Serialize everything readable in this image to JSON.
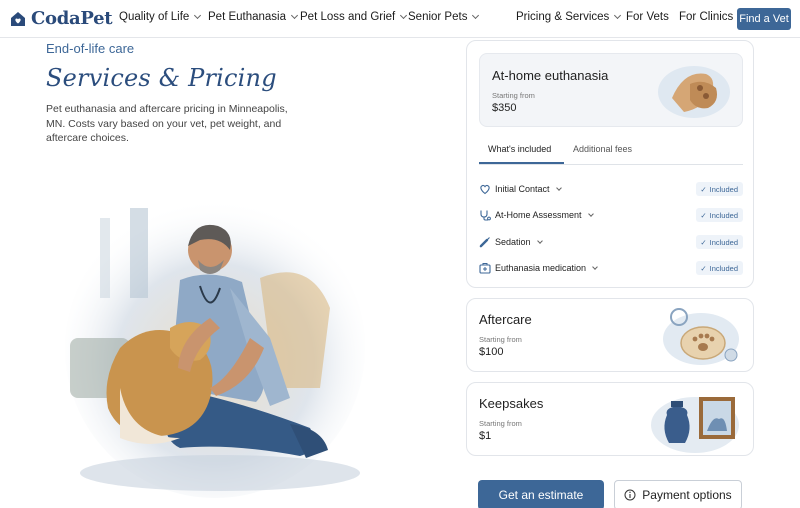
{
  "brand": {
    "name": "CodaPet"
  },
  "nav": {
    "items": [
      {
        "label": "Quality of Life",
        "dropdown": true
      },
      {
        "label": "Pet Euthanasia",
        "dropdown": true
      },
      {
        "label": "Pet Loss and Grief",
        "dropdown": true
      },
      {
        "label": "Senior Pets",
        "dropdown": true
      },
      {
        "label": "Pricing & Services",
        "dropdown": true
      },
      {
        "label": "For Vets",
        "dropdown": false
      },
      {
        "label": "For Clinics",
        "dropdown": false
      }
    ],
    "cta": "Find a Vet"
  },
  "hero": {
    "eyebrow": "End-of-life care",
    "title": "Services & Pricing",
    "description": "Pet euthanasia and aftercare pricing in Minneapolis, MN. Costs vary based on your vet, pet weight, and aftercare choices."
  },
  "main_service": {
    "title": "At-home euthanasia",
    "starting_label": "Starting from",
    "price": "$350",
    "tabs": [
      "What's included",
      "Additional fees"
    ],
    "active_tab": 0,
    "included_items": [
      {
        "label": "Initial Contact",
        "status": "Included",
        "icon": "heart-icon"
      },
      {
        "label": "At-Home Assessment",
        "status": "Included",
        "icon": "stethoscope-icon"
      },
      {
        "label": "Sedation",
        "status": "Included",
        "icon": "syringe-icon"
      },
      {
        "label": "Euthanasia medication",
        "status": "Included",
        "icon": "medical-kit-icon"
      }
    ]
  },
  "aftercare": {
    "title": "Aftercare",
    "starting_label": "Starting from",
    "price": "$100"
  },
  "keepsakes": {
    "title": "Keepsakes",
    "starting_label": "Starting from",
    "price": "$1"
  },
  "actions": {
    "primary": "Get an estimate",
    "secondary": "Payment options"
  },
  "colors": {
    "accent": "#3d6797",
    "panel_bg": "#f3f5f8",
    "badge_bg": "#eef3f9"
  }
}
